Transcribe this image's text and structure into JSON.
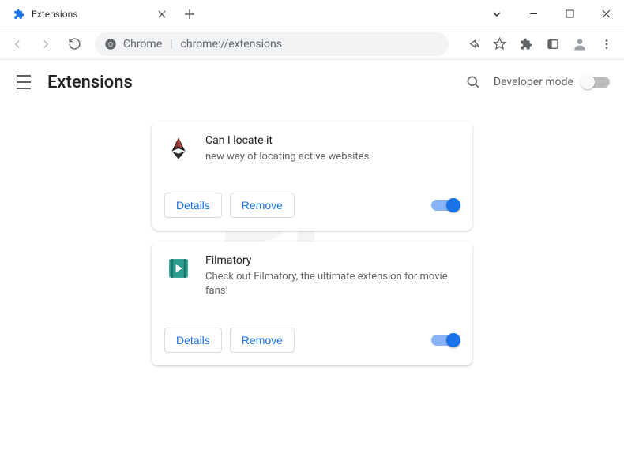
{
  "window": {
    "tab_title": "Extensions"
  },
  "omnibox": {
    "scheme": "Chrome",
    "path": "chrome://extensions"
  },
  "header": {
    "title": "Extensions",
    "dev_mode_label": "Developer mode",
    "dev_mode_on": false
  },
  "buttons": {
    "details": "Details",
    "remove": "Remove"
  },
  "extensions": [
    {
      "name": "Can I locate it",
      "description": "new way of locating active websites",
      "enabled": true,
      "icon": "wing-logo"
    },
    {
      "name": "Filmatory",
      "description": "Check out Filmatory, the ultimate extension for movie fans!",
      "enabled": true,
      "icon": "film-logo"
    }
  ]
}
